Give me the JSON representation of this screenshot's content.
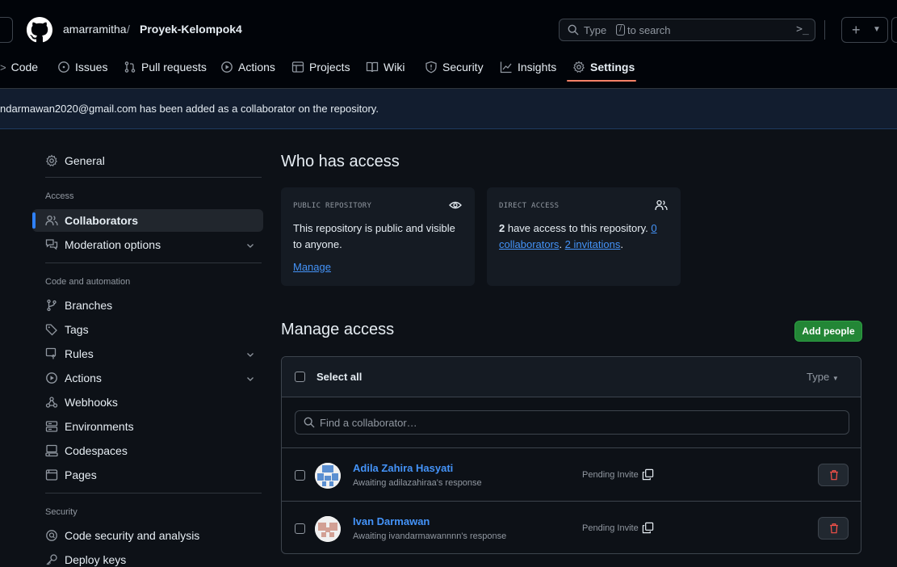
{
  "header": {
    "repo_owner": "amarramitha",
    "separator": "/",
    "repo_name": "Proyek-Kelompok4",
    "search_placeholder_before": "Type",
    "search_slash_key": "/",
    "search_placeholder_after": "to search",
    "command_palette_label": ">_",
    "create_new_label": "+"
  },
  "tabs": [
    {
      "label": "Code",
      "icon": "code-icon"
    },
    {
      "label": "Issues",
      "icon": "issue-icon"
    },
    {
      "label": "Pull requests",
      "icon": "pull-request-icon"
    },
    {
      "label": "Actions",
      "icon": "play-icon"
    },
    {
      "label": "Projects",
      "icon": "table-icon"
    },
    {
      "label": "Wiki",
      "icon": "book-icon"
    },
    {
      "label": "Security",
      "icon": "shield-icon"
    },
    {
      "label": "Insights",
      "icon": "graph-icon"
    },
    {
      "label": "Settings",
      "icon": "gear-icon",
      "active": true
    }
  ],
  "flash": {
    "message": "ndarmawan2020@gmail.com has been added as a collaborator on the repository."
  },
  "sidebar": {
    "general": "General",
    "access_heading": "Access",
    "collaborators": "Collaborators",
    "moderation": "Moderation options",
    "code_automation_heading": "Code and automation",
    "branches": "Branches",
    "tags": "Tags",
    "rules": "Rules",
    "actions": "Actions",
    "webhooks": "Webhooks",
    "environments": "Environments",
    "codespaces": "Codespaces",
    "pages": "Pages",
    "security_heading": "Security",
    "code_security": "Code security and analysis",
    "deploy_keys": "Deploy keys"
  },
  "who_has_access": {
    "title": "Who has access",
    "public_card": {
      "label": "PUBLIC REPOSITORY",
      "text_1": "This repository is public and visible",
      "text_2": "to anyone.",
      "manage_link": "Manage"
    },
    "direct_card": {
      "label": "DIRECT ACCESS",
      "count": "2",
      "text_a": " have access to this repository. ",
      "collab_count": "0",
      "collab_link": "collaborators",
      "sep": ". ",
      "invitations_link": "2 invitations",
      "end": "."
    }
  },
  "manage_access": {
    "title": "Manage access",
    "add_button": "Add people",
    "select_all": "Select all",
    "type_filter": "Type",
    "find_placeholder": "Find a collaborator…",
    "collaborators": [
      {
        "name": "Adila Zahira Hasyati",
        "status": "Awaiting adilazahiraa's response",
        "invite": "Pending Invite"
      },
      {
        "name": "Ivan Darmawan",
        "status": "Awaiting ivandarmawannnn's response",
        "invite": "Pending Invite"
      }
    ]
  },
  "colors": {
    "accent_link": "#4493f8",
    "active_tab_underline": "#f78166",
    "add_button_bg": "#238636",
    "danger": "#f85149"
  }
}
